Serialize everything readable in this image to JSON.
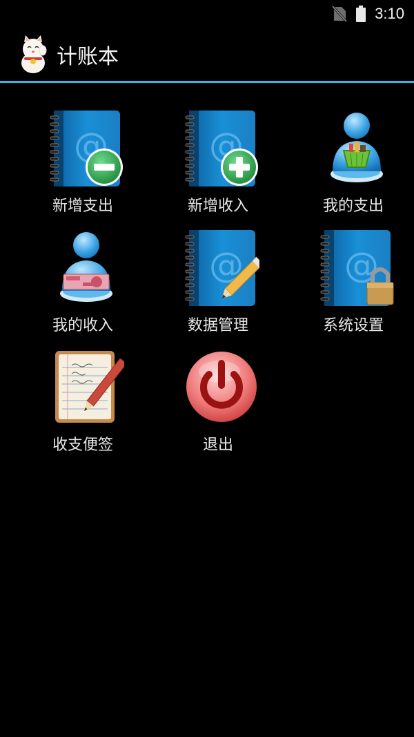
{
  "status_bar": {
    "time": "3:10",
    "signal_icon": "no-sim-icon",
    "battery_icon": "battery-icon"
  },
  "app": {
    "title": "计账本",
    "icon": "lucky-cat-icon"
  },
  "menu": [
    {
      "label": "新增支出",
      "icon": "address-book-minus-icon"
    },
    {
      "label": "新增收入",
      "icon": "address-book-plus-icon"
    },
    {
      "label": "我的支出",
      "icon": "user-shopping-basket-icon"
    },
    {
      "label": "我的收入",
      "icon": "user-money-icon"
    },
    {
      "label": "数据管理",
      "icon": "address-book-pencil-icon"
    },
    {
      "label": "系统设置",
      "icon": "address-book-lock-icon"
    },
    {
      "label": "收支便签",
      "icon": "notepad-pencil-icon"
    },
    {
      "label": "退出",
      "icon": "power-icon"
    }
  ],
  "colors": {
    "accent": "#33b5e5",
    "background": "#000000"
  }
}
